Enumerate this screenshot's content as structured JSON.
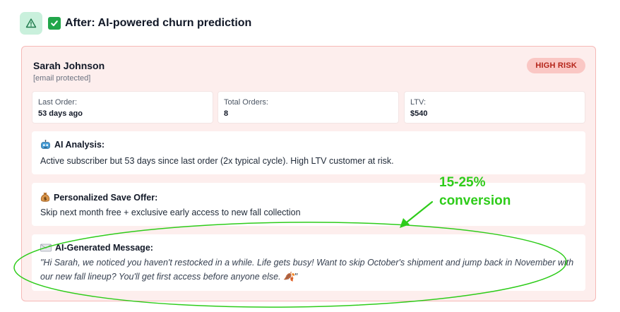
{
  "header": {
    "title": "After: AI-powered churn prediction",
    "warning_icon": "warning-triangle-icon",
    "check_icon": "check-mark-icon"
  },
  "customer": {
    "name": "Sarah Johnson",
    "email": "[email protected]",
    "risk_badge": "HIGH RISK"
  },
  "stats": [
    {
      "label": "Last Order:",
      "value": "53 days ago"
    },
    {
      "label": "Total Orders:",
      "value": "8"
    },
    {
      "label": "LTV:",
      "value": "$540"
    }
  ],
  "analysis": {
    "title": "AI Analysis:",
    "icon": "robot-icon",
    "text": "Active subscriber but 53 days since last order (2x typical cycle). High LTV customer at risk."
  },
  "offer": {
    "title": "Personalized Save Offer:",
    "icon": "money-bag-icon",
    "text": "Skip next month free + exclusive early access to new fall collection"
  },
  "message": {
    "title": "AI-Generated Message:",
    "icon": "envelope-icon",
    "text": "\"Hi Sarah, we noticed you haven't restocked in a while. Life gets busy! Want to skip October's shipment and jump back in November with our new fall lineup? You'll get first access before anyone else. 🍂\""
  },
  "annotation": {
    "line1": "15-25%",
    "line2": "conversion",
    "color": "#2ecc1a"
  },
  "colors": {
    "card_bg": "#fdeeed",
    "card_border": "#f6b9b7",
    "risk_bg": "#fac7c4",
    "risk_text": "#b42318",
    "check_green": "#22a64a",
    "warning_badge_bg": "#c9f0dc"
  }
}
